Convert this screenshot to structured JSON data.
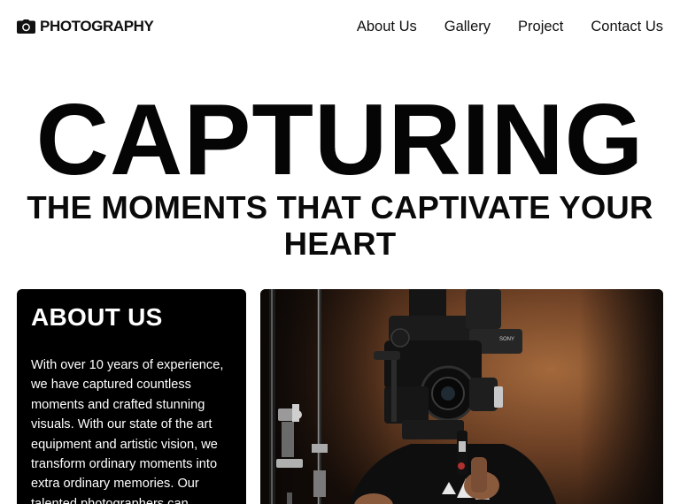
{
  "header": {
    "brand_icon": "camera-icon",
    "brand": "PHOTOGRAPHY",
    "nav": [
      {
        "label": "About Us"
      },
      {
        "label": "Gallery"
      },
      {
        "label": "Project"
      },
      {
        "label": "Contact Us"
      }
    ]
  },
  "hero": {
    "title": "CAPTURING",
    "subtitle": "THE MOMENTS THAT CAPTIVATE YOUR HEART"
  },
  "about": {
    "heading": "ABOUT US",
    "body": "With over 10 years of experience, we have captured countless moments and crafted stunning visuals. With our state of the art equipment and artistic vision, we transform ordinary moments into extra ordinary memories. Our talented photographers can"
  },
  "photo": {
    "camera_brand": "SONY",
    "colors": {
      "wall": "#6a3f24",
      "wall_light": "#9a6238",
      "shadow": "#0b0706"
    }
  }
}
